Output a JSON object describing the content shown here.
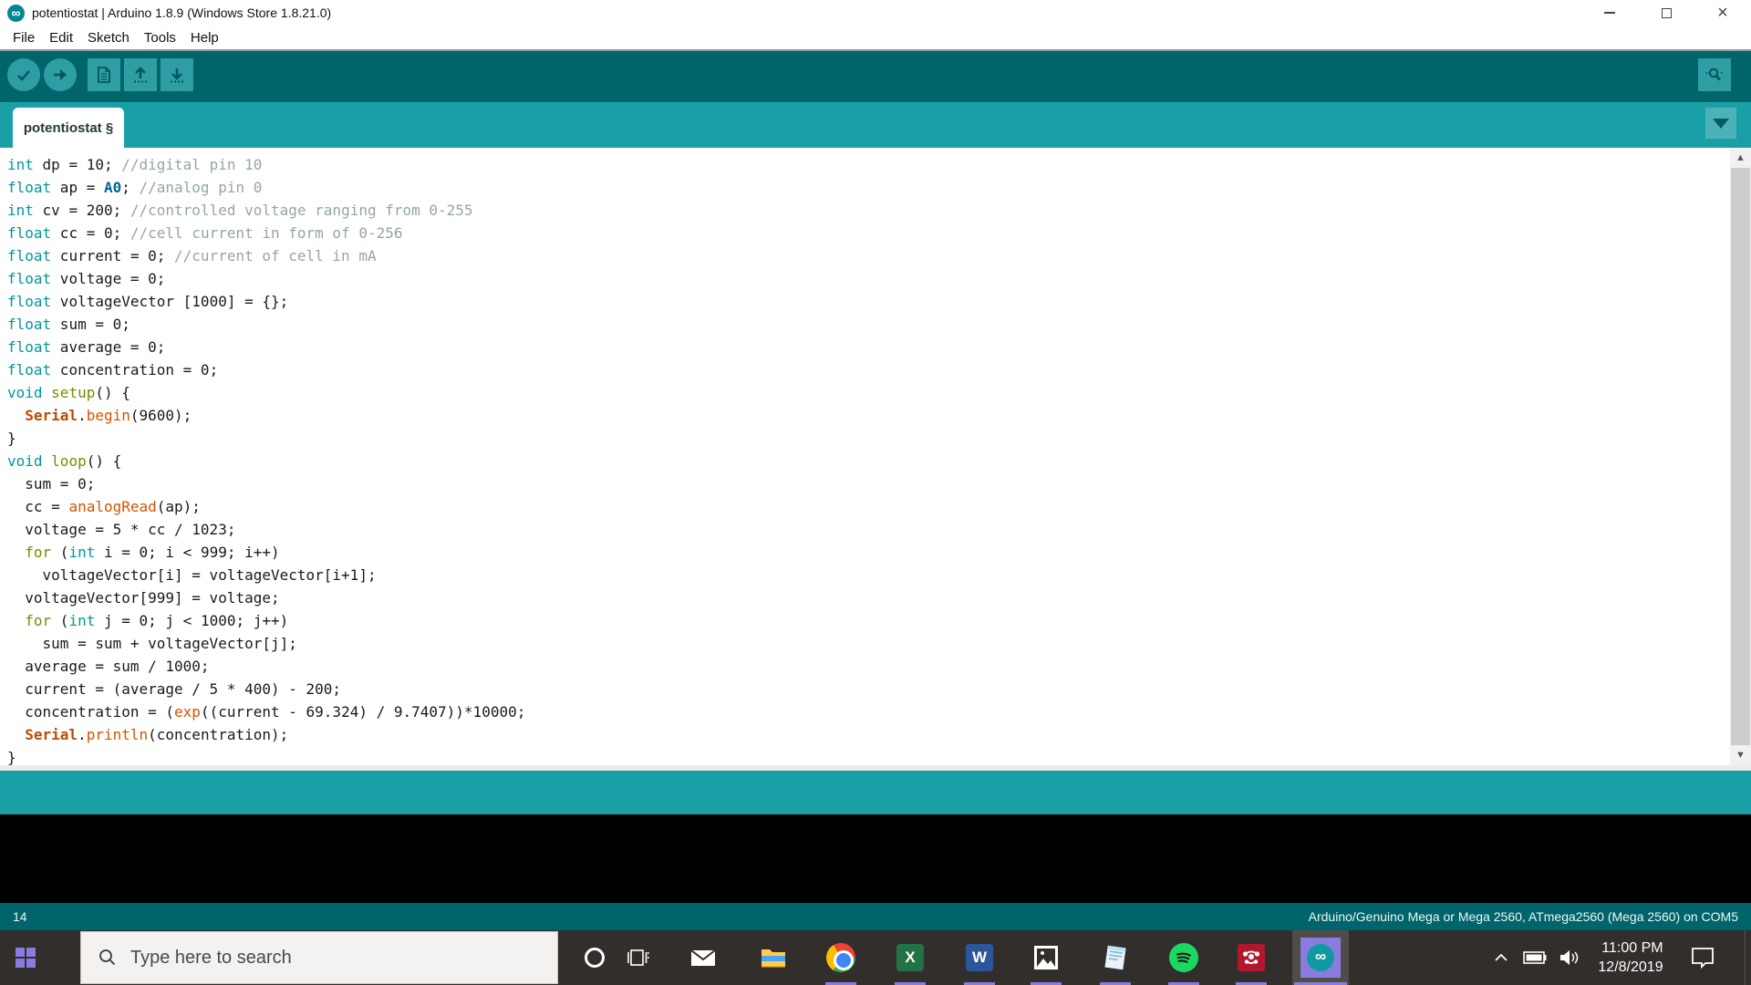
{
  "window": {
    "title": "potentiostat | Arduino 1.8.9 (Windows Store 1.8.21.0)",
    "app_icon": "arduino-infinity-icon",
    "infinity_glyph": "∞"
  },
  "menu": {
    "items": [
      "File",
      "Edit",
      "Sketch",
      "Tools",
      "Help"
    ]
  },
  "toolbar": {
    "buttons": [
      "verify",
      "upload",
      "new",
      "open",
      "save"
    ],
    "serial_monitor": "serial-monitor"
  },
  "tabbar": {
    "active_tab": "potentiostat §"
  },
  "editor": {
    "lines": [
      [
        [
          "int",
          "k"
        ],
        [
          " dp = 10; ",
          "p"
        ],
        [
          "//digital pin 10",
          "c"
        ]
      ],
      [
        [
          "float",
          "k"
        ],
        [
          " ap = ",
          "p"
        ],
        [
          "A0",
          "a"
        ],
        [
          "; ",
          "p"
        ],
        [
          "//analog pin 0",
          "c"
        ]
      ],
      [
        [
          "int",
          "k"
        ],
        [
          " cv = 200; ",
          "p"
        ],
        [
          "//controlled voltage ranging from 0-255",
          "c"
        ]
      ],
      [
        [
          "float",
          "k"
        ],
        [
          " cc = 0; ",
          "p"
        ],
        [
          "//cell current in form of 0-256",
          "c"
        ]
      ],
      [
        [
          "float",
          "k"
        ],
        [
          " current = 0; ",
          "p"
        ],
        [
          "//current of cell in mA",
          "c"
        ]
      ],
      [
        [
          "float",
          "k"
        ],
        [
          " voltage = 0;",
          "p"
        ]
      ],
      [
        [
          "float",
          "k"
        ],
        [
          " voltageVector [1000] = {};",
          "p"
        ]
      ],
      [
        [
          "float",
          "k"
        ],
        [
          " sum = 0;",
          "p"
        ]
      ],
      [
        [
          "float",
          "k"
        ],
        [
          " average = 0;",
          "p"
        ]
      ],
      [
        [
          "float",
          "k"
        ],
        [
          " concentration = 0;",
          "p"
        ]
      ],
      [
        [
          "void",
          "k"
        ],
        [
          " ",
          "p"
        ],
        [
          "setup",
          "f"
        ],
        [
          "() {",
          "p"
        ]
      ],
      [
        [
          "  ",
          "p"
        ],
        [
          "Serial",
          "s"
        ],
        [
          ".",
          "p"
        ],
        [
          "begin",
          "o"
        ],
        [
          "(9600);",
          "p"
        ]
      ],
      [
        [
          "}",
          "p"
        ]
      ],
      [
        [
          "void",
          "k"
        ],
        [
          " ",
          "p"
        ],
        [
          "loop",
          "f"
        ],
        [
          "() {",
          "p"
        ]
      ],
      [
        [
          "  sum = 0;",
          "p"
        ]
      ],
      [
        [
          "  cc = ",
          "p"
        ],
        [
          "analogRead",
          "o"
        ],
        [
          "(ap);",
          "p"
        ]
      ],
      [
        [
          "  voltage = 5 * cc / 1023;",
          "p"
        ]
      ],
      [
        [
          "  ",
          "p"
        ],
        [
          "for",
          "f"
        ],
        [
          " (",
          "p"
        ],
        [
          "int",
          "k"
        ],
        [
          " i = 0; i < 999; i++)",
          "p"
        ]
      ],
      [
        [
          "    voltageVector[i] = voltageVector[i+1];",
          "p"
        ]
      ],
      [
        [
          "  voltageVector[999] = voltage;",
          "p"
        ]
      ],
      [
        [
          "  ",
          "p"
        ],
        [
          "for",
          "f"
        ],
        [
          " (",
          "p"
        ],
        [
          "int",
          "k"
        ],
        [
          " j = 0; j < 1000; j++)",
          "p"
        ]
      ],
      [
        [
          "    sum = sum + voltageVector[j];",
          "p"
        ]
      ],
      [
        [
          "  average = sum / 1000;",
          "p"
        ]
      ],
      [
        [
          "  current = (average / 5 * 400) - 200;",
          "p"
        ]
      ],
      [
        [
          "  concentration = (",
          "p"
        ],
        [
          "exp",
          "o"
        ],
        [
          "((current - 69.324) / 9.7407))*10000;",
          "p"
        ]
      ],
      [
        [
          "  ",
          "p"
        ],
        [
          "Serial",
          "s"
        ],
        [
          ".",
          "p"
        ],
        [
          "println",
          "o"
        ],
        [
          "(concentration);",
          "p"
        ]
      ],
      [
        [
          "}",
          "p"
        ]
      ]
    ]
  },
  "message_area": {
    "text": ""
  },
  "status": {
    "line_number": "14",
    "board_info": "Arduino/Genuino Mega or Mega 2560, ATmega2560 (Mega 2560) on COM5"
  },
  "taskbar": {
    "search": {
      "placeholder": "Type here to search"
    },
    "apps": [
      {
        "name": "task-view",
        "running": false,
        "active": false
      },
      {
        "name": "mail",
        "running": false,
        "active": false
      },
      {
        "name": "file-explorer",
        "running": false,
        "active": false
      },
      {
        "name": "chrome",
        "running": true,
        "active": false
      },
      {
        "name": "excel",
        "running": true,
        "active": false
      },
      {
        "name": "word",
        "running": true,
        "active": false
      },
      {
        "name": "photos",
        "running": true,
        "active": false
      },
      {
        "name": "notepad",
        "running": true,
        "active": false
      },
      {
        "name": "spotify",
        "running": true,
        "active": false
      },
      {
        "name": "mendeley",
        "running": true,
        "active": false
      },
      {
        "name": "arduino",
        "running": true,
        "active": true
      }
    ],
    "office_letters": {
      "excel": "X",
      "word": "W"
    },
    "tray": {
      "time": "11:00 PM",
      "date": "12/8/2019"
    }
  },
  "colors": {
    "toolbar_teal": "#00646B",
    "tabbar_teal": "#18A0A6",
    "button_teal": "#2F9EA4",
    "keyword": "#00979C",
    "function_name": "#728E00",
    "function_call": "#D35400",
    "serial": "#BC4A00",
    "constant": "#006699",
    "comment": "#95A5A6",
    "accent_purple": "#8A7CDF",
    "spotify_green": "#1ED760",
    "console_black": "#000000"
  }
}
